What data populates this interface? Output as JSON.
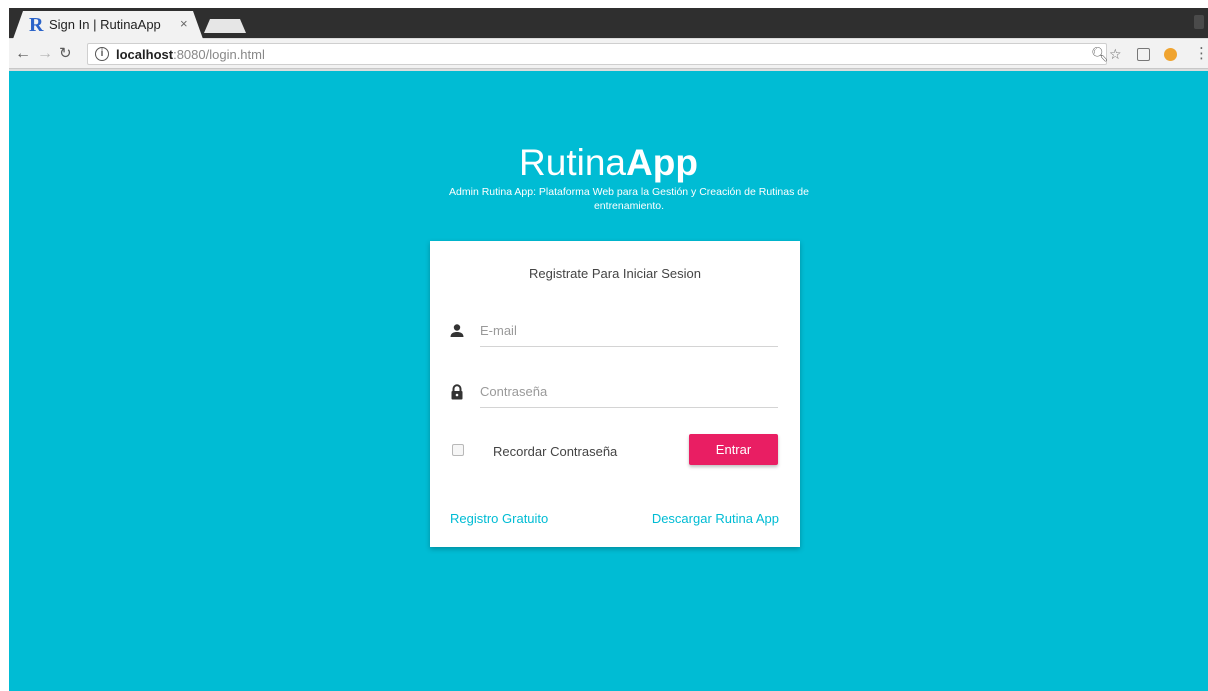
{
  "browser": {
    "tab_title": "Sign In | RutinaApp",
    "tab_favicon": "R",
    "close_glyph": "×",
    "url_host": "localhost",
    "url_rest": ":8080/login.html",
    "icons": [
      "back-icon",
      "forward-icon",
      "reload-icon",
      "info-icon",
      "zoom-icon",
      "star-icon",
      "extension-icon",
      "cookie-icon",
      "menu-icon"
    ]
  },
  "brand": {
    "name_light": "Rutina",
    "name_bold": "App",
    "subtitle": "Admin Rutina App: Plataforma Web para la Gestión y Creación de Rutinas de entrenamiento."
  },
  "login": {
    "title": "Registrate Para Iniciar Sesion",
    "email_placeholder": "E-mail",
    "password_placeholder": "Contraseña",
    "remember_label": "Recordar Contraseña",
    "submit_label": "Entrar",
    "register_link": "Registro Gratuito",
    "download_link": "Descargar Rutina App"
  },
  "colors": {
    "background": "#00bcd4",
    "accent_button": "#e91e63",
    "link": "#00bcd4"
  }
}
